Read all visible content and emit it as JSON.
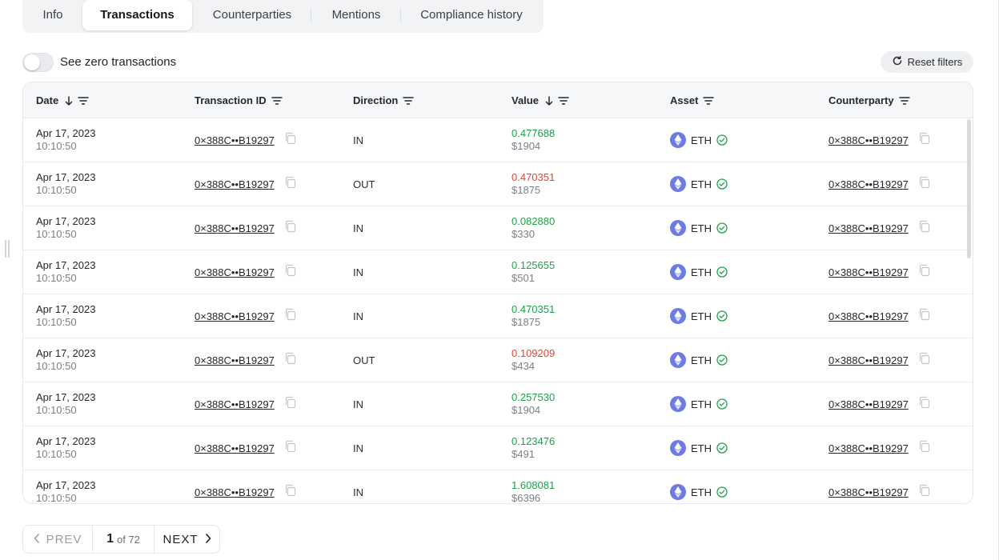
{
  "tabs": [
    {
      "label": "Info"
    },
    {
      "label": "Transactions"
    },
    {
      "label": "Counterparties"
    },
    {
      "label": "Mentions"
    },
    {
      "label": "Compliance history"
    }
  ],
  "toggle": {
    "label": "See zero transactions",
    "on": false
  },
  "reset_filters": {
    "label": "Reset filters"
  },
  "table": {
    "columns": [
      "Date",
      "Transaction ID",
      "Direction",
      "Value",
      "Asset",
      "Counterparty"
    ],
    "rows": [
      {
        "date": "Apr 17, 2023",
        "time": "10:10:50",
        "txid": "0×388C••B19297",
        "direction": "IN",
        "value": "0.477688",
        "usd": "$1904",
        "asset": "ETH",
        "counterparty": "0×388C••B19297"
      },
      {
        "date": "Apr 17, 2023",
        "time": "10:10:50",
        "txid": "0×388C••B19297",
        "direction": "OUT",
        "value": "0.470351",
        "usd": "$1875",
        "asset": "ETH",
        "counterparty": "0×388C••B19297"
      },
      {
        "date": "Apr 17, 2023",
        "time": "10:10:50",
        "txid": "0×388C••B19297",
        "direction": "IN",
        "value": "0.082880",
        "usd": "$330",
        "asset": "ETH",
        "counterparty": "0×388C••B19297"
      },
      {
        "date": "Apr 17, 2023",
        "time": "10:10:50",
        "txid": "0×388C••B19297",
        "direction": "IN",
        "value": "0.125655",
        "usd": "$501",
        "asset": "ETH",
        "counterparty": "0×388C••B19297"
      },
      {
        "date": "Apr 17, 2023",
        "time": "10:10:50",
        "txid": "0×388C••B19297",
        "direction": "IN",
        "value": "0.470351",
        "usd": "$1875",
        "asset": "ETH",
        "counterparty": "0×388C••B19297"
      },
      {
        "date": "Apr 17, 2023",
        "time": "10:10:50",
        "txid": "0×388C••B19297",
        "direction": "OUT",
        "value": "0.109209",
        "usd": "$434",
        "asset": "ETH",
        "counterparty": "0×388C••B19297"
      },
      {
        "date": "Apr 17, 2023",
        "time": "10:10:50",
        "txid": "0×388C••B19297",
        "direction": "IN",
        "value": "0.257530",
        "usd": "$1904",
        "asset": "ETH",
        "counterparty": "0×388C••B19297"
      },
      {
        "date": "Apr 17, 2023",
        "time": "10:10:50",
        "txid": "0×388C••B19297",
        "direction": "IN",
        "value": "0.123476",
        "usd": "$491",
        "asset": "ETH",
        "counterparty": "0×388C••B19297"
      },
      {
        "date": "Apr 17, 2023",
        "time": "10:10:50",
        "txid": "0×388C••B19297",
        "direction": "IN",
        "value": "1.608081",
        "usd": "$6396",
        "asset": "ETH",
        "counterparty": "0×388C••B19297"
      }
    ]
  },
  "pagination": {
    "prev": "PREV",
    "current": "1",
    "of_total": "of 72",
    "next": "NEXT"
  },
  "colors": {
    "in": "#1fa04a",
    "out": "#e0442f",
    "eth": "#6c7ce0"
  }
}
